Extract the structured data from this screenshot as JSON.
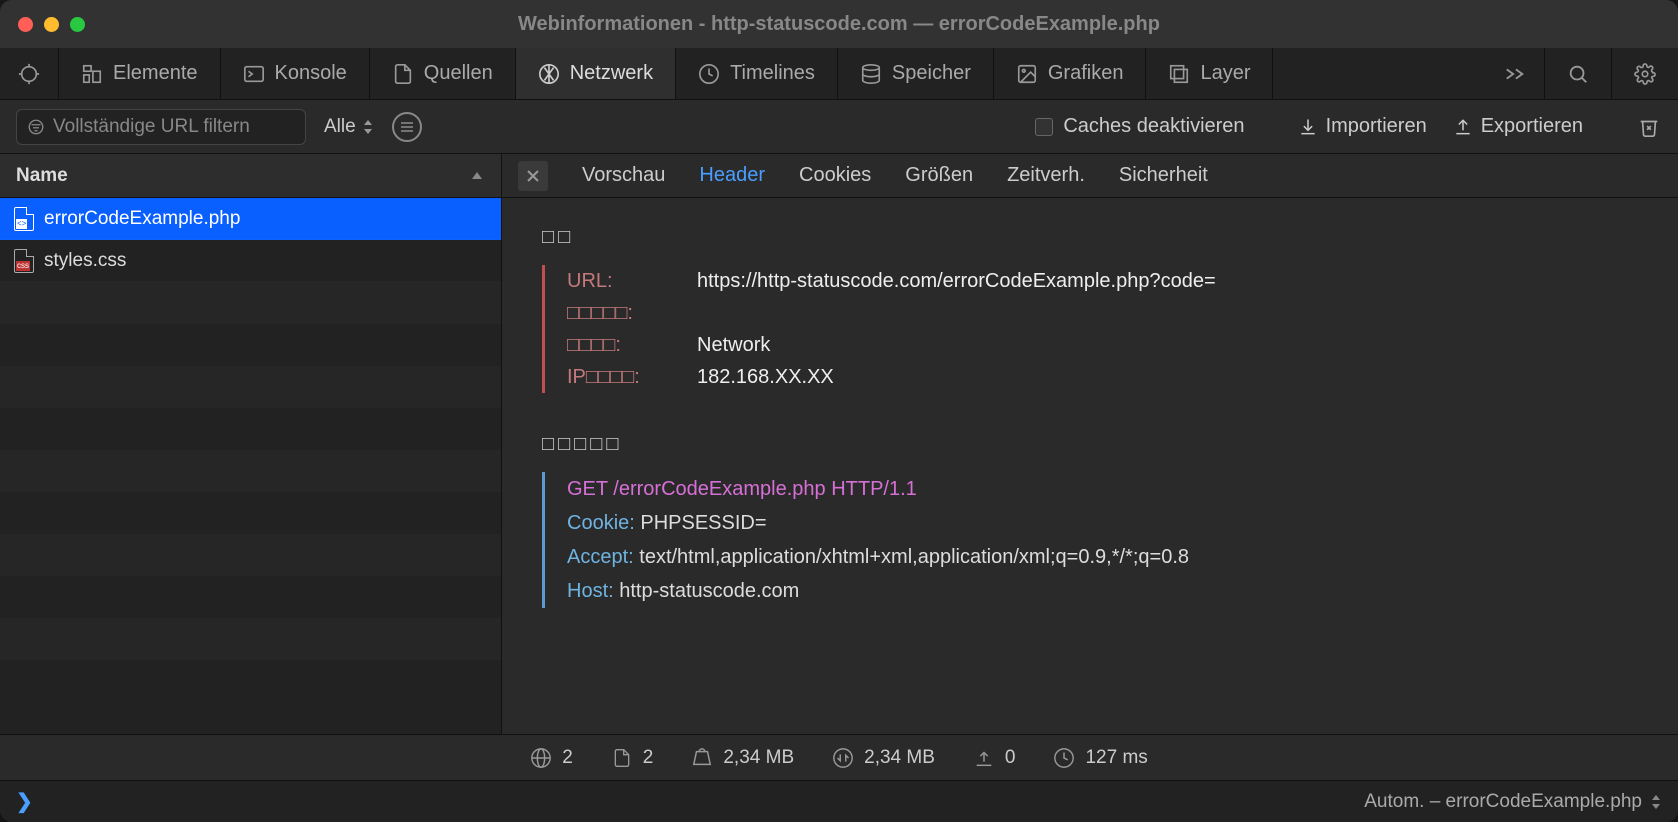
{
  "window": {
    "title": "Webinformationen - http-statuscode.com — errorCodeExample.php"
  },
  "tabs": [
    {
      "key": "target",
      "label": ""
    },
    {
      "key": "elements",
      "label": "Elemente"
    },
    {
      "key": "console",
      "label": "Konsole"
    },
    {
      "key": "sources",
      "label": "Quellen"
    },
    {
      "key": "network",
      "label": "Netzwerk"
    },
    {
      "key": "timelines",
      "label": "Timelines"
    },
    {
      "key": "storage",
      "label": "Speicher"
    },
    {
      "key": "graphics",
      "label": "Grafiken"
    },
    {
      "key": "layers",
      "label": "Layer"
    }
  ],
  "active_tab": "network",
  "toolbar": {
    "filter_placeholder": "Vollständige URL filtern",
    "mode": "Alle",
    "disable_caches": "Caches deaktivieren",
    "import": "Importieren",
    "export": "Exportieren"
  },
  "sidebar": {
    "header": "Name",
    "files": [
      {
        "name": "errorCodeExample.php",
        "type": "php",
        "selected": true
      },
      {
        "name": "styles.css",
        "type": "css",
        "selected": false
      }
    ]
  },
  "detail": {
    "tabs": [
      "Vorschau",
      "Header",
      "Cookies",
      "Größen",
      "Zeitverh.",
      "Sicherheit"
    ],
    "active": "Header",
    "summary_title": "□□",
    "summary": [
      {
        "label": "URL:",
        "value": "https://http-statuscode.com/errorCodeExample.php?code="
      },
      {
        "label": "□□□□□:",
        "value": ""
      },
      {
        "label": "□□□□:",
        "value": "Network"
      },
      {
        "label": "IP□□□□:",
        "value": "182.168.XX.XX"
      }
    ],
    "request_title": "□□□□□",
    "request_line": "GET /errorCodeExample.php HTTP/1.1",
    "request_headers": [
      {
        "name": "Cookie:",
        "value": "PHPSESSID="
      },
      {
        "name": "Accept:",
        "value": "text/html,application/xhtml+xml,application/xml;q=0.9,*/*;q=0.8"
      },
      {
        "name": "Host:",
        "value": "http-statuscode.com"
      }
    ]
  },
  "status": {
    "domains": "2",
    "resources": "2",
    "size": "2,34 MB",
    "transferred": "2,34 MB",
    "loads": "0",
    "time": "127 ms"
  },
  "console": {
    "context": "Autom. – errorCodeExample.php"
  }
}
